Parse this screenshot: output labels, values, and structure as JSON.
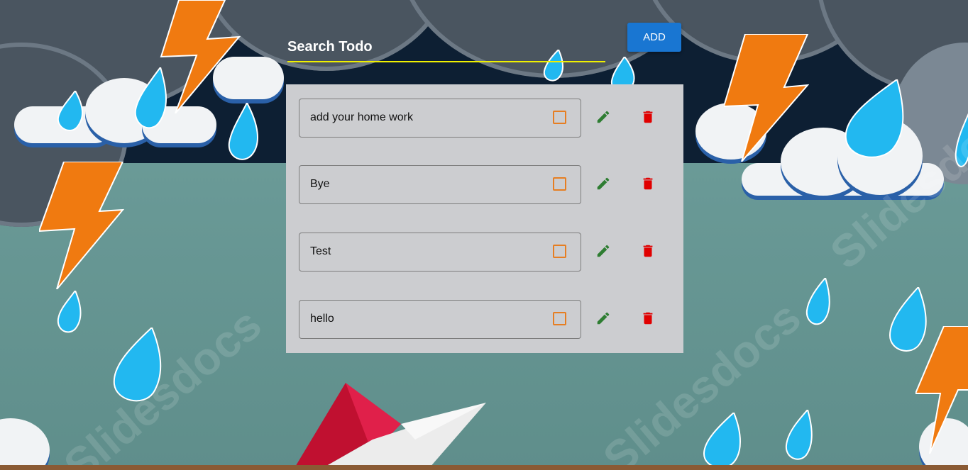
{
  "search": {
    "placeholder": "Search Todo",
    "value": ""
  },
  "add_button": {
    "label": "ADD"
  },
  "watermark": "Slidesdocs",
  "todos": [
    {
      "text": "add your home work",
      "done": false
    },
    {
      "text": "Bye",
      "done": false
    },
    {
      "text": "Test",
      "done": false
    },
    {
      "text": "hello",
      "done": false
    }
  ],
  "colors": {
    "accent": "#1976d2",
    "underline": "#f0f000",
    "checkbox": "#e67e22",
    "edit": "#2e7d32",
    "delete": "#e00000",
    "panel": "#cccdd0"
  },
  "icons": {
    "edit": "pencil-icon",
    "delete": "trash-icon"
  }
}
